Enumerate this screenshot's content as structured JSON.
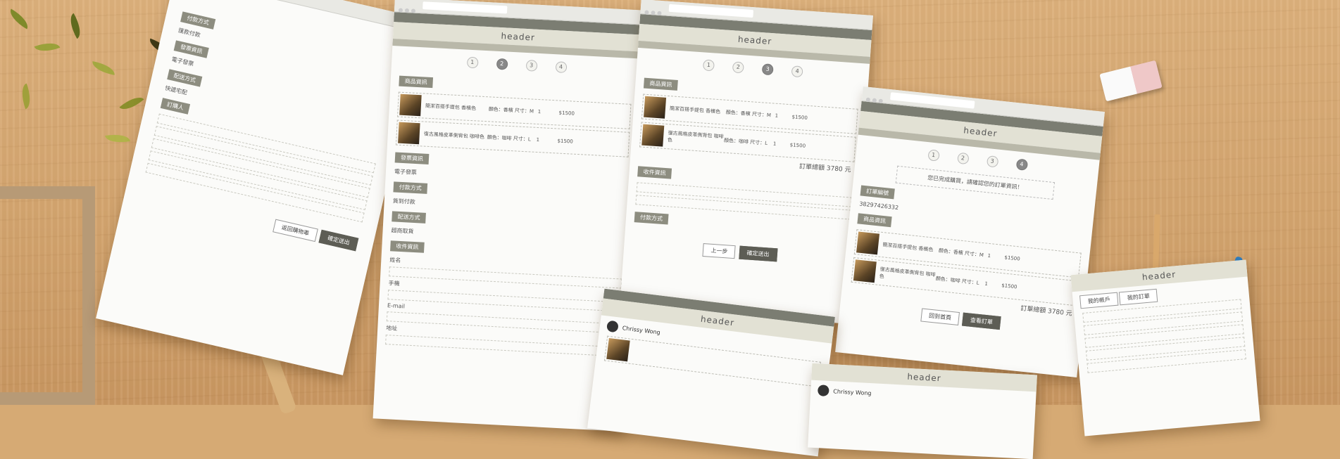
{
  "scene": {
    "description_colors": {
      "desk": "#d6aa74",
      "paper": "#fbfbf9",
      "accent": "#5d5d55",
      "pen": "#2f7fc1"
    }
  },
  "sheets": {
    "sheet_top_left": {
      "labels": [
        "付款方式",
        "發票資訊",
        "配送方式",
        "訂購人"
      ],
      "lines": [
        "匯款付款",
        "電子發票",
        "快遞宅配"
      ],
      "buttons": {
        "back": "返回購物車",
        "next": "確定送出"
      }
    },
    "sheet_checkout": {
      "header": "header",
      "steps": [
        "1",
        "2",
        "3",
        "4"
      ],
      "sections": [
        "商品資訊",
        "發票資訊",
        "付款方式",
        "配送方式",
        "收件資訊"
      ],
      "items": [
        {
          "name": "簡潔百搭手提包 香檳色",
          "spec": "顏色：香檳 尺寸：M",
          "qty": "1",
          "price": "$1500"
        },
        {
          "name": "復古風格皮革側背包 咖啡色",
          "spec": "顏色：咖啡 尺寸：L",
          "qty": "1",
          "price": "$1500"
        }
      ],
      "lines": [
        "電子發票",
        "貨到付款",
        "超商取貨"
      ],
      "fields": [
        "姓名",
        "手機",
        "E-mail",
        "地址"
      ]
    },
    "sheet_confirm": {
      "header": "header",
      "steps": [
        "1",
        "2",
        "3",
        "4"
      ],
      "sections": [
        "商品資訊",
        "收件資訊",
        "付款方式"
      ],
      "items": [
        {
          "name": "簡潔百搭手提包 香檳色",
          "spec": "顏色：香檳 尺寸：M",
          "qty": "1",
          "price": "$1500"
        },
        {
          "name": "復古風格皮革側背包 咖啡色",
          "spec": "顏色：咖啡 尺寸：L",
          "qty": "1",
          "price": "$1500"
        }
      ],
      "total": "訂單總額 3780 元",
      "buttons": {
        "back": "上一步",
        "next": "確定送出"
      }
    },
    "sheet_done": {
      "header": "header",
      "steps": [
        "1",
        "2",
        "3",
        "4"
      ],
      "message": "您已完成購買，請確認您的訂單資訊！",
      "sections": [
        "訂單編號",
        "商品資訊"
      ],
      "order_no": "38297426332",
      "items": [
        {
          "name": "簡潔百搭手提包 香檳色",
          "spec": "顏色：香檳 尺寸：M",
          "qty": "1",
          "price": "$1500"
        },
        {
          "name": "復古風格皮革側背包 咖啡色",
          "spec": "顏色：咖啡 尺寸：L",
          "qty": "1",
          "price": "$1500"
        }
      ],
      "total": "訂單總額 3780 元",
      "buttons": {
        "home": "回到首頁",
        "orders": "查看訂單"
      }
    },
    "sheet_member": {
      "header": "header",
      "user": "Chrissy Wong"
    },
    "sheet_member2": {
      "header": "header",
      "user": "Chrissy Wong"
    },
    "sheet_orders": {
      "header": "header",
      "tabs": [
        "我的帳戶",
        "我的訂單"
      ]
    }
  }
}
